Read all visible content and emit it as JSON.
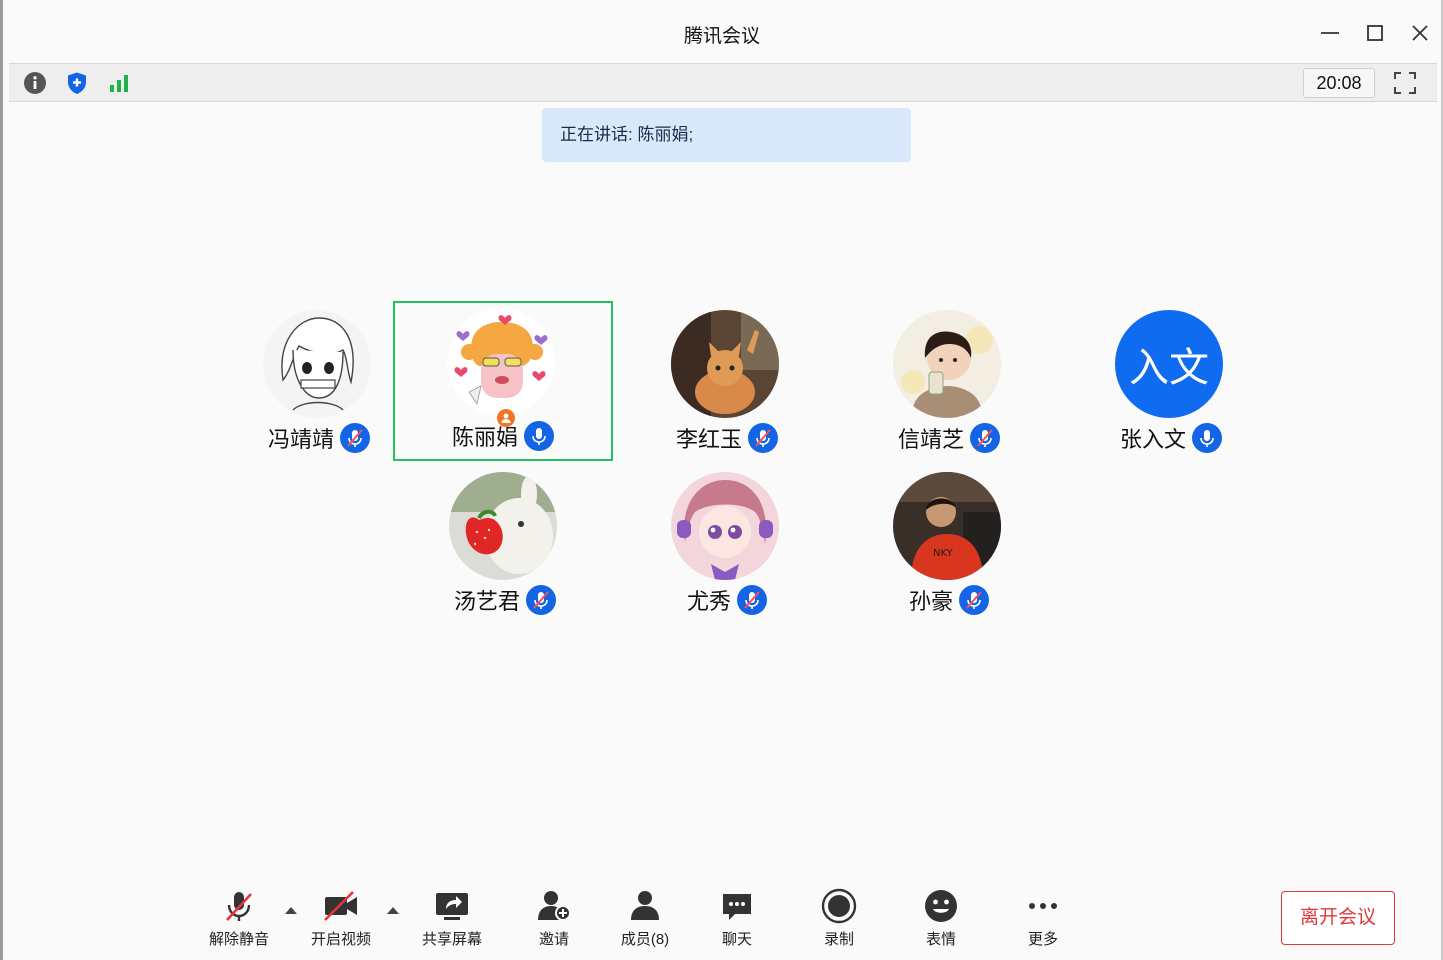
{
  "window": {
    "title": "腾讯会议"
  },
  "infobar": {
    "clock": "20:08",
    "icons": [
      "info-icon",
      "shield-icon",
      "signal-icon",
      "fullscreen-icon"
    ]
  },
  "speaking": {
    "text": "正在讲话: 陈丽娟;"
  },
  "participants": [
    {
      "name": "冯靖靖",
      "mic": "muted",
      "avatar": "sketch-girl"
    },
    {
      "name": "陈丽娟",
      "mic": "on",
      "avatar": "cartoon-doll",
      "host": true,
      "active": true
    },
    {
      "name": "李红玉",
      "mic": "muted",
      "avatar": "cat-photo"
    },
    {
      "name": "信靖芝",
      "mic": "muted",
      "avatar": "child-photo"
    },
    {
      "name": "张入文",
      "mic": "on",
      "avatar": "text",
      "avatar_text": "入文",
      "avatar_color": "#0f6cf0"
    },
    {
      "name": "汤艺君",
      "mic": "muted",
      "avatar": "rabbit-strawberry"
    },
    {
      "name": "尤秀",
      "mic": "muted",
      "avatar": "anime-girl"
    },
    {
      "name": "孙豪",
      "mic": "muted",
      "avatar": "man-photo"
    }
  ],
  "toolbar": {
    "unmute": "解除静音",
    "video": "开启视频",
    "share": "共享屏幕",
    "invite": "邀请",
    "members": "成员(8)",
    "chat": "聊天",
    "record": "录制",
    "emoji": "表情",
    "more": "更多",
    "leave": "离开会议"
  },
  "colors": {
    "accent": "#1464e6",
    "active_border": "#23c260",
    "leave": "#e0383a",
    "banner": "#d9e8fb"
  }
}
